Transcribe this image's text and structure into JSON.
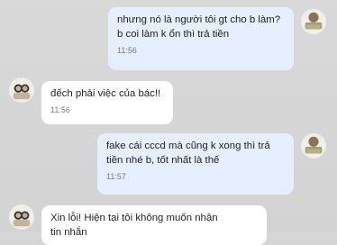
{
  "messages": [
    {
      "direction": "outgoing",
      "text": "nhưng nó là người tôi gt cho b làm?\nb coi làm k ổn thì trả tiền",
      "time": "11:56",
      "avatar_icon": "landscape-photo-avatar"
    },
    {
      "direction": "incoming",
      "text": "đếch phải việc của bác!!",
      "time": "11:56",
      "avatar_icon": "couple-photo-avatar"
    },
    {
      "direction": "outgoing",
      "text": "fake cái cccd mà cũng k xong thì trả\ntiền nhé b, tốt nhất là thế",
      "time": "11:57",
      "avatar_icon": "landscape-photo-avatar"
    },
    {
      "direction": "incoming",
      "text": "Xin lỗi! Hiện tại tôi không muốn nhận\ntin nhắn",
      "time": "",
      "avatar_icon": "couple-photo-avatar"
    }
  ],
  "colors": {
    "background": "#d6d6d6",
    "outgoing_bubble": "#e5efff",
    "incoming_bubble": "#ffffff",
    "time_text": "#7b7b7b"
  }
}
